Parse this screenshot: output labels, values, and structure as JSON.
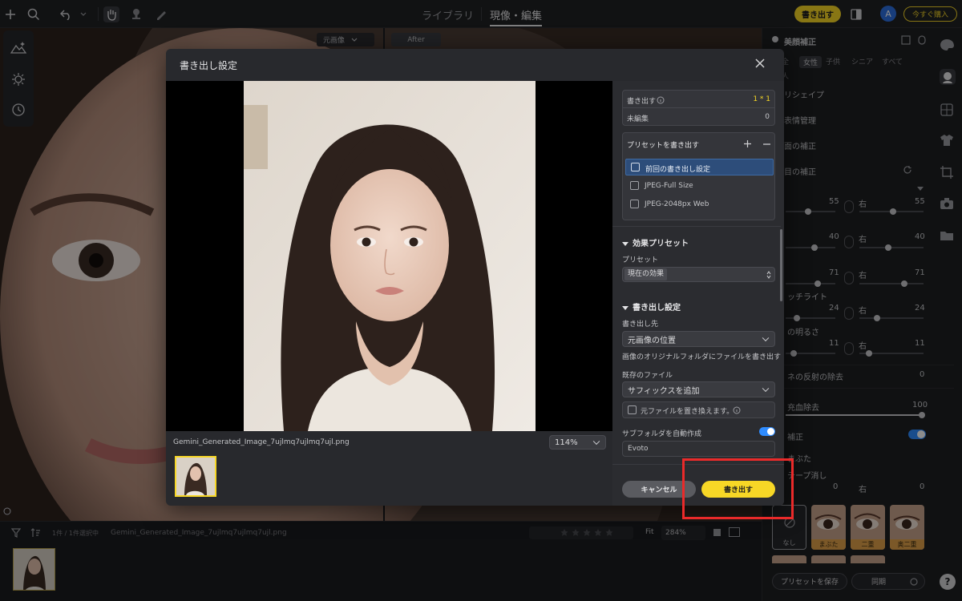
{
  "topbar": {
    "nav_library": "ライブラリ",
    "nav_develop": "現像・編集",
    "export_button": "書き出す",
    "avatar_letter": "A",
    "buy_button": "今すぐ購入",
    "icons": [
      "plus-icon",
      "search-icon",
      "undo-icon",
      "hand-icon",
      "stamp-icon",
      "brush-icon",
      "window-icon"
    ]
  },
  "canvas": {
    "original_dropdown": "元画像",
    "after_label": "After"
  },
  "right_panel": {
    "title": "美顔補正",
    "tabs": [
      "全",
      "女性",
      "子供",
      "シニア",
      "すべて"
    ],
    "tab_extra": "人",
    "reshape_label": "リシェイプ",
    "expression_label": "表情管理",
    "correction_label_1": "面の補正",
    "correction_label_2": "目の補正",
    "sliders": [
      {
        "left_val": "55",
        "right_label": "右",
        "right_val": "55"
      },
      {
        "left_val": "40",
        "right_label": "右",
        "right_val": "40"
      },
      {
        "left_val": "71",
        "right_label": "右",
        "right_val": "71"
      },
      {
        "left_val": "24",
        "right_label": "右",
        "right_val": "24"
      },
      {
        "left_val": "11",
        "right_label": "右",
        "right_val": "11"
      }
    ],
    "catchlight_label": "ッチライト",
    "brightness_label": "の明るさ",
    "reflection_label": "ネの反射の除去",
    "reflection_val": "0",
    "redeye_label": "充血除去",
    "redeye_val": "100",
    "correct_label": "補正",
    "mabuta_label": "まぶた",
    "tape_label": "テープ消し",
    "tape_left_val": "0",
    "tape_right_label": "右",
    "tape_right_val": "0",
    "thumbs": [
      "なし",
      "まぶた",
      "二重",
      "奥二重"
    ],
    "save_preset": "プリセットを保存",
    "sync": "同期",
    "help": "?"
  },
  "bottombar": {
    "selection_count": "1件 / 1件選択中",
    "filename": "Gemini_Generated_Image_7ujlmq7ujlmq7ujl.png",
    "fit_label": "Fit",
    "zoom": "284%"
  },
  "modal": {
    "title": "書き出し設定",
    "filename": "Gemini_Generated_Image_7ujlmq7ujlmq7ujl.png",
    "zoom": "114%",
    "export_count_label": "書き出す",
    "export_count_value": "1 * 1",
    "unedited_label": "未編集",
    "unedited_value": "0",
    "preset_header": "プリセットを書き出す",
    "presets": [
      {
        "label": "前回の書き出し設定",
        "selected": true
      },
      {
        "label": "JPEG-Full Size",
        "selected": false
      },
      {
        "label": "JPEG-2048px Web",
        "selected": false
      }
    ],
    "effects_section": "効果プリセット",
    "preset_label": "プリセット",
    "preset_value": "現在の効果",
    "export_section": "書き出し設定",
    "destination_label": "書き出し先",
    "destination_value": "元画像の位置",
    "destination_help": "画像のオリジナルフォルダにファイルを書き出す",
    "existing_label": "既存のファイル",
    "existing_value": "サフィックスを追加",
    "overwrite_label": "元ファイルを置き換えます。",
    "subfolder_label": "サブフォルダを自動作成",
    "subfolder_value": "Evoto",
    "cancel_button": "キャンセル",
    "export_button": "書き出す"
  },
  "colors": {
    "accent_yellow": "#f7d726",
    "toggle_blue": "#2f8cff",
    "highlight_red": "#ea2a2a",
    "selected_row": "#2d4d7a"
  }
}
